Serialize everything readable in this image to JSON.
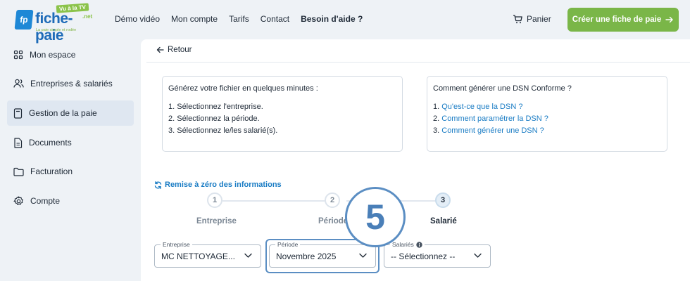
{
  "logo": {
    "abbr": "fp",
    "brand": "fiche-paie",
    "tld": ".net",
    "badge": "Vu à la TV",
    "tagline": "La paie simple et rodée"
  },
  "nav": {
    "items": [
      "Démo vidéo",
      "Mon compte",
      "Tarifs",
      "Contact",
      "Besoin d'aide ?"
    ],
    "cart": "Panier",
    "cta": "Créer une fiche de paie"
  },
  "sidebar": {
    "items": [
      {
        "label": "Mon espace",
        "icon": "grid-icon"
      },
      {
        "label": "Entreprises & salariés",
        "icon": "users-icon"
      },
      {
        "label": "Gestion de la paie",
        "icon": "document-icon",
        "active": true
      },
      {
        "label": "Documents",
        "icon": "file-icon"
      },
      {
        "label": "Facturation",
        "icon": "folder-icon"
      },
      {
        "label": "Compte",
        "icon": "gear-icon"
      }
    ]
  },
  "main": {
    "back": "Retour",
    "card_left": {
      "title": "Générez votre fichier en quelques minutes :",
      "lines": [
        "1. Sélectionnez l'entreprise.",
        "2. Sélectionnez la période.",
        "3. Sélectionnez le/les salarié(s)."
      ]
    },
    "card_right": {
      "title": "Comment générer une DSN Conforme ?",
      "lines": [
        {
          "num": "1.",
          "link": "Qu'est-ce que la DSN ?"
        },
        {
          "num": "2.",
          "link": "Comment paramétrer la DSN ?"
        },
        {
          "num": "3.",
          "link": "Comment générer une DSN ?"
        }
      ]
    },
    "reset": "Remise à zéro des informations",
    "steps": [
      {
        "num": "1",
        "label": "Entreprise"
      },
      {
        "num": "2",
        "label": "Période"
      },
      {
        "num": "3",
        "label": "Salarié",
        "active": true
      }
    ],
    "fields": {
      "entreprise": {
        "label": "Entreprise",
        "value": "MC NETTOYAGE..."
      },
      "periode": {
        "label": "Période",
        "value": "Novembre 2025"
      },
      "salaries": {
        "label": "Salariés",
        "value": "-- Sélectionnez --"
      }
    },
    "annotation_number": "5"
  },
  "colors": {
    "accent_green": "#7ab648",
    "link_blue": "#1a7cc4",
    "annotation_blue": "#5b8ec3"
  }
}
